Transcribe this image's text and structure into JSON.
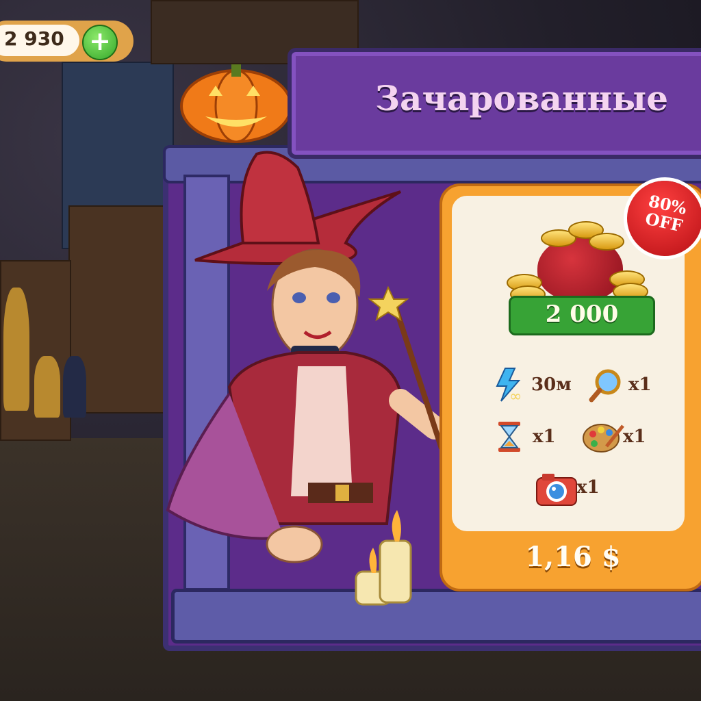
{
  "hud": {
    "coins": "2 930"
  },
  "offer": {
    "title": "Зачарованные",
    "badge": "80% OFF",
    "coins_amount": "2 000",
    "bonuses": [
      {
        "icon": "infinite-energy-icon",
        "label": "30м"
      },
      {
        "icon": "magnifier-icon",
        "label": "x1"
      },
      {
        "icon": "hourglass-icon",
        "label": "x1"
      },
      {
        "icon": "palette-icon",
        "label": "x1"
      },
      {
        "icon": "camera-icon",
        "label": "x1"
      }
    ],
    "price": "1,16 $"
  },
  "colors": {
    "sign_purple": "#6a3b9e",
    "card_orange": "#f7a230",
    "ribbon_green": "#37a336",
    "badge_red": "#d7262e"
  }
}
